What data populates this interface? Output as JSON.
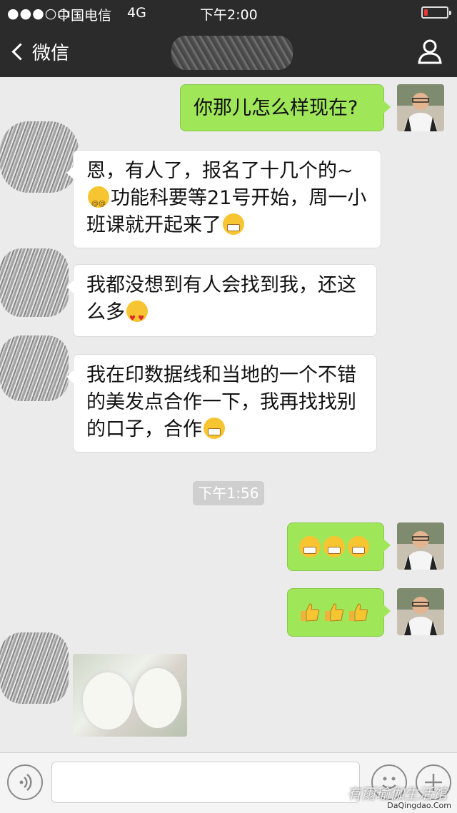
{
  "status_bar": {
    "signal": "●●●○○",
    "carrier": "中国电信",
    "network": "4G",
    "time": "下午2:00",
    "battery_level": 0.15,
    "battery_color": "#e53935"
  },
  "nav": {
    "back_label": "微信",
    "profile_icon": "person-icon"
  },
  "messages": [
    {
      "dir": "out",
      "text": "你那儿怎么样现在?"
    },
    {
      "dir": "in",
      "line1": "恩，有人了，报名了十几个的~",
      "line2_emoji": "dizzy",
      "line2": "功能科要等21号开始，周一小",
      "line3": "班课就开起来了",
      "line3_emoji": "grin"
    },
    {
      "dir": "in",
      "line1": "我都没想到有人会找到我，还这",
      "line2": "么多",
      "line2_emoji": "heart-eyes"
    },
    {
      "dir": "in",
      "line1": "我在印数据线和当地的一个不错",
      "line2": "的美发点合作一下，我再找找别",
      "line3": "的口子，合作",
      "line3_emoji": "grin"
    },
    {
      "dir": "out",
      "emojis": [
        "grin",
        "grin",
        "grin"
      ]
    },
    {
      "dir": "out",
      "emojis": [
        "thumbs-up",
        "thumbs-up",
        "thumbs-up"
      ]
    },
    {
      "dir": "in",
      "type": "image",
      "content": "two white bunnies photo"
    }
  ],
  "timestamp": "下午1:56",
  "input_bar": {
    "voice_icon": "voice-icon",
    "emoji_icon": "emoji-icon",
    "add_icon": "plus-icon"
  },
  "watermark": {
    "text": "有爾瑜伽生活馆",
    "site": "DaQingdao.Com"
  },
  "colors": {
    "header": "#2b2b2b",
    "chat_bg": "#ebebeb",
    "bubble_out": "#9fe659",
    "bubble_in": "#ffffff"
  }
}
